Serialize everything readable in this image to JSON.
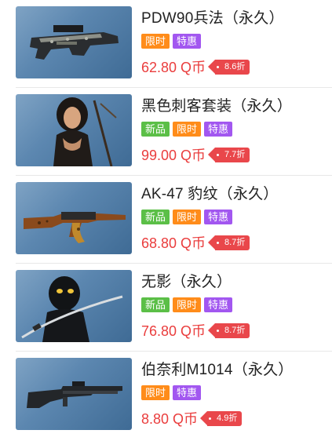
{
  "items": [
    {
      "title": "PDW90兵法（永久）",
      "image": "pdw90-gun-image",
      "tags": [
        {
          "label": "限时",
          "type": "limit"
        },
        {
          "label": "特惠",
          "type": "sale"
        }
      ],
      "price": "62.80 Q币",
      "discount": "8.6折"
    },
    {
      "title": "黑色刺客套装（永久）",
      "image": "black-assassin-character-image",
      "tags": [
        {
          "label": "新品",
          "type": "new"
        },
        {
          "label": "限时",
          "type": "limit"
        },
        {
          "label": "特惠",
          "type": "sale"
        }
      ],
      "price": "99.00 Q币",
      "discount": "7.7折"
    },
    {
      "title": "AK-47 豹纹（永久）",
      "image": "ak47-leopard-gun-image",
      "tags": [
        {
          "label": "新品",
          "type": "new"
        },
        {
          "label": "限时",
          "type": "limit"
        },
        {
          "label": "特惠",
          "type": "sale"
        }
      ],
      "price": "68.80 Q币",
      "discount": "8.7折"
    },
    {
      "title": "无影（永久）",
      "image": "shadow-ninja-character-image",
      "tags": [
        {
          "label": "新品",
          "type": "new"
        },
        {
          "label": "限时",
          "type": "limit"
        },
        {
          "label": "特惠",
          "type": "sale"
        }
      ],
      "price": "76.80 Q币",
      "discount": "8.7折"
    },
    {
      "title": "伯奈利M1014（永久）",
      "image": "benelli-m1014-shotgun-image",
      "tags": [
        {
          "label": "限时",
          "type": "limit"
        },
        {
          "label": "特惠",
          "type": "sale"
        }
      ],
      "price": "8.80 Q币",
      "discount": "4.9折"
    }
  ],
  "colors": {
    "title": "#222222",
    "price": "#ea3d3d",
    "tag_limit": "#ff8c1a",
    "tag_sale": "#a257f0",
    "tag_new": "#5bbf47",
    "discount_badge": "#e9474b"
  }
}
